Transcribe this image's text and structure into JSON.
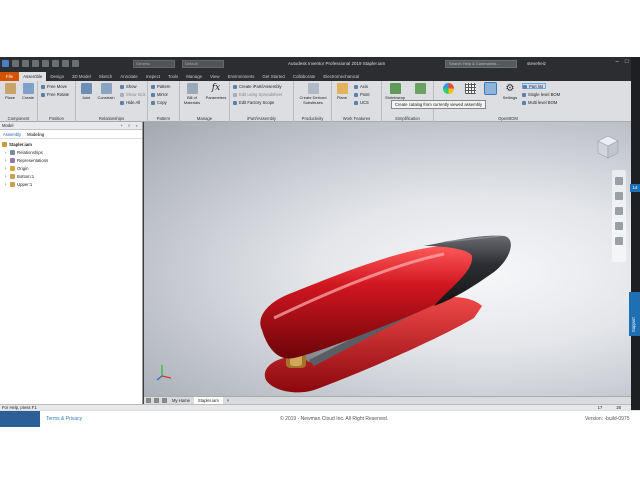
{
  "app": {
    "title": "Autodesk Inventor Professional 2019   Stapler.iam",
    "search_placeholder": "Search Help & Commands...",
    "user": "steveheiz",
    "combo1": "Generic",
    "combo2": "Default"
  },
  "tabs": [
    "File",
    "Assemble",
    "Design",
    "3D Model",
    "Sketch",
    "Annotate",
    "Inspect",
    "Tools",
    "Manage",
    "View",
    "Environments",
    "Get Started",
    "Collaborate",
    "Electromechanical"
  ],
  "ribbon": {
    "component": {
      "title": "Component",
      "place": "Place",
      "create": "Create"
    },
    "position": {
      "title": "Position",
      "free_move": "Free Move",
      "free_rotate": "Free Rotate"
    },
    "relationships": {
      "title": "Relationships",
      "joint": "Joint",
      "constrain": "Constrain",
      "show": "Show",
      "show_sick": "Show Sick",
      "hide_all": "Hide All"
    },
    "pattern": {
      "title": "Pattern",
      "pattern": "Pattern",
      "mirror": "Mirror",
      "copy": "Copy"
    },
    "manage": {
      "title": "Manage",
      "bom": "Bill of Materials",
      "parameters": "Parameters"
    },
    "ipart": {
      "title": "iPart/iAssembly",
      "create": "Create iPart/iAssembly",
      "edit_sheet": "Edit using Spreadsheet",
      "edit_scope": "Edit Factory Scope"
    },
    "productivity": {
      "title": "Productivity",
      "create_derived": "Create Derived Substitutes"
    },
    "work_features": {
      "title": "Work Features",
      "plane": "Plane",
      "axis": "Axis",
      "point": "Point",
      "ucs": "UCS"
    },
    "simplification": {
      "title": "Simplification",
      "shrinkwrap": "Shrinkwrap"
    },
    "openbom": {
      "title": "OpenBOM",
      "settings": "Settings",
      "part_list": "Part list",
      "single_level": "Single level BOM",
      "multi_level": "Multi level BOM"
    },
    "tooltip": "Create catalog from currently viewed assembly"
  },
  "browser": {
    "header": "Model",
    "tabs": [
      "Assembly",
      "Modeling"
    ],
    "tree": [
      {
        "label": "Stapler.iam",
        "root": true
      },
      {
        "label": "Relationships"
      },
      {
        "label": "Representations"
      },
      {
        "label": "Origin"
      },
      {
        "label": "Bottom:1"
      },
      {
        "label": "Upper:1"
      }
    ]
  },
  "doc_tabs": [
    "My Home",
    "Stapler.iam"
  ],
  "status": {
    "text": "For Help, press F1",
    "n1": "17",
    "n2": "26"
  },
  "side": {
    "badge": "14",
    "support": "Support"
  },
  "footer": {
    "terms": "Terms & Privacy",
    "copyright": "© 2019 - Newman Cloud Inc. All Right Reserved.",
    "version": "Version: -build-0975"
  },
  "colors": {
    "accent": "#d35400",
    "stapler_red": "#c4121c",
    "stapler_dark": "#2e2f33",
    "support_blue": "#1f6fb3"
  }
}
